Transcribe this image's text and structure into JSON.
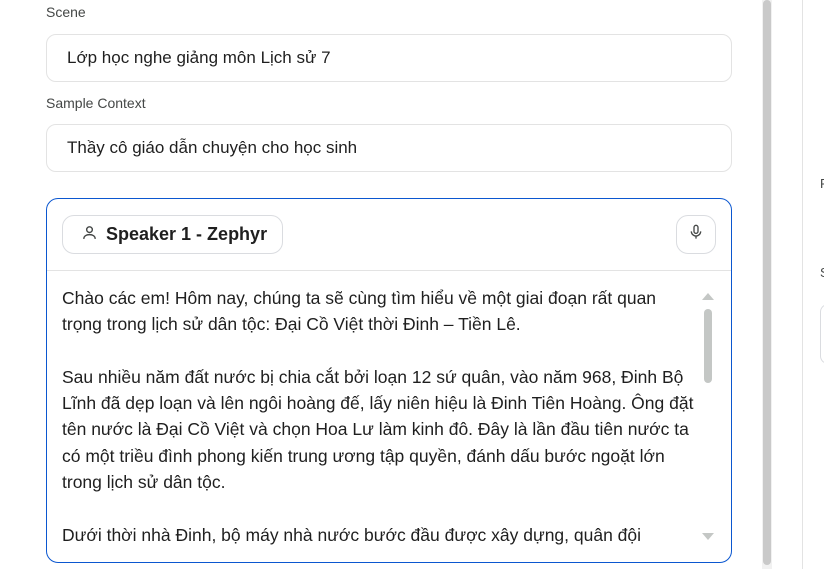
{
  "scene": {
    "label": "Scene",
    "value": "Lớp học nghe giảng môn Lịch sử 7"
  },
  "sample_context": {
    "label": "Sample Context",
    "value": "Thầy cô giáo dẫn chuyện cho học sinh"
  },
  "speaker_card": {
    "speaker_label": "Speaker 1 - Zephyr",
    "speaker_icon": "person-icon",
    "mic_icon": "microphone-icon",
    "transcript": [
      "Chào các em! Hôm nay, chúng ta sẽ cùng tìm hiểu về một giai đoạn rất quan trọng trong lịch sử dân tộc: Đại Cồ Việt thời Đinh – Tiền Lê.",
      "Sau nhiều năm đất nước bị chia cắt bởi loạn 12 sứ quân, vào năm 968, Đinh Bộ Lĩnh đã dẹp loạn và lên ngôi hoàng đế, lấy niên hiệu là Đinh Tiên Hoàng. Ông đặt tên nước là Đại Cồ Việt và chọn Hoa Lư làm kinh đô. Đây là lần đầu tiên nước ta có một triều đình phong kiến trung ương tập quyền, đánh dấu bước ngoặt lớn trong lịch sử dân tộc.",
      "Dưới thời nhà Đinh, bộ máy nhà nước bước đầu được xây dựng, quân đội"
    ]
  },
  "right_panel": {
    "glyph_top": "F",
    "glyph_bottom": "S"
  },
  "colors": {
    "accent_border": "#0b57d0",
    "field_border": "#e3e3e3",
    "scrollbar": "#c4c7c5"
  }
}
